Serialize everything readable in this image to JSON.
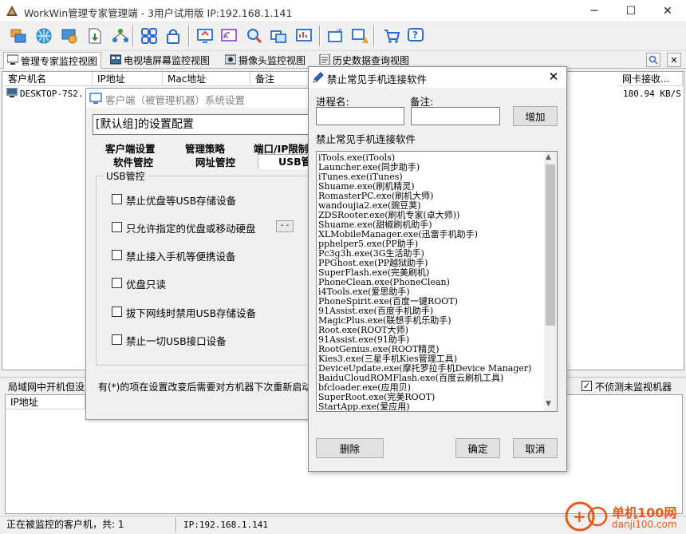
{
  "window": {
    "title": "WorkWin管理专家管理端 - 3用户试用版 IP:192.168.1.141"
  },
  "controls": {
    "minimize": "─",
    "maximize": "☐",
    "close": "✕"
  },
  "tabs": [
    {
      "label": "管理专家监控视图",
      "icon": "monitor-view-icon"
    },
    {
      "label": "电视墙屏幕监控视图",
      "icon": "tv-wall-icon"
    },
    {
      "label": "摄像头监控视图",
      "icon": "camera-icon"
    },
    {
      "label": "历史数据查询视图",
      "icon": "history-icon"
    }
  ],
  "list": {
    "columns": [
      "客户机名",
      "IP地址",
      "Mac地址",
      "备注",
      "网卡接收..."
    ],
    "rows": [
      {
        "name": "DESKTOP-7S2...",
        "nic_recv": "180.94 KB/S"
      }
    ]
  },
  "client_window": {
    "title": "客户端（被管理机器）系统设置",
    "config_label": "[默认组]的设置配置",
    "tabs_row1": [
      "客户端设置",
      "管理策略",
      "端口/IP限制"
    ],
    "tabs_row2": [
      "软件管控",
      "网址管控",
      "USB管控"
    ],
    "group": "USB管控",
    "options": [
      "禁止优盘等USB存储设备",
      "只允许指定的优盘或移动硬盘",
      "禁止接入手机等便携设备",
      "优盘只读",
      "拔下网线时禁用USB存储设备",
      "禁止一切USB接口设备"
    ],
    "dots": "- -",
    "notice": "有(*)的项在设置改变后需要对方机器下次重新启动"
  },
  "dialog": {
    "title": "禁止常见手机连接软件",
    "process_label": "进程名:",
    "remark_label": "备注:",
    "add_button": "增加",
    "list_label": "禁止常见手机连接软件",
    "items": [
      "iTools.exe(iTools)",
      "Launcher.exe(同步助手)",
      "iTunes.exe(iTunes)",
      "Shuame.exe(刷机精灵)",
      "RomasterPC.exe(刷机大师)",
      "wandoujia2.exe(豌豆荚)",
      "ZDSRooter.exe(刷机专家(卓大师))",
      "Shuame.exe(甜椒刷机助手)",
      "XLMobileManager.exe(迅雷手机助手)",
      "pphelper5.exe(PP助手)",
      "Pc3g3h.exe(3G生活助手)",
      "PPGhost.exe(PP越狱助手)",
      "SuperFlash.exe(完美刷机)",
      "PhoneClean.exe(PhoneClean)",
      "i4Tools.exe(爱思助手)",
      "PhoneSpirit.exe(百度一键ROOT)",
      "91Assist.exe(百度手机助手)",
      "MagicPlus.exe(联想手机乐助手)",
      "Root.exe(ROOT大师)",
      "91Assist.exe(91助手)",
      "RootGenius.exe(ROOT精灵)",
      "Kies3.exe(三星手机Kies管理工具)",
      "DeviceUpdate.exe(摩托罗拉手机Device Manager)",
      "BaiduCloudROMFlash.exe(百度云刷机工具)",
      "bfcloader.exe(应用贝)",
      "SuperRoot.exe(完美ROOT)",
      "StartApp.exe(爱应用)"
    ],
    "delete_button": "删除",
    "ok_button": "确定",
    "cancel_button": "取消"
  },
  "lower": {
    "label": "局域网中开机但没",
    "checkbox_label": "不侦测未监视机器",
    "column": "IP地址"
  },
  "status": {
    "monitored": "正在被监控的客户机，共: 1",
    "ip": "IP:192.168.1.141"
  },
  "watermark": {
    "text": "单机100网",
    "url": "danji100.com"
  }
}
